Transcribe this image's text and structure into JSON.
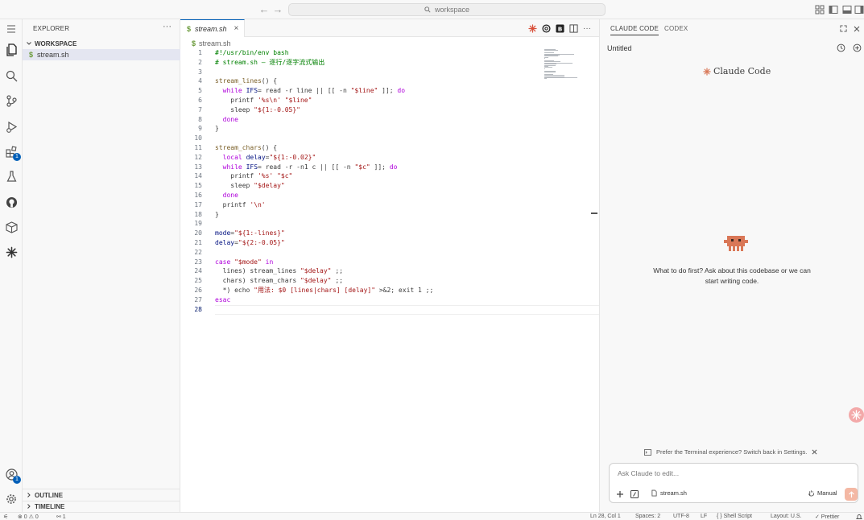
{
  "titlebar": {
    "back_icon": "arrow-left-icon",
    "forward_icon": "arrow-right-icon",
    "search_placeholder": "workspace"
  },
  "sidebar": {
    "title": "EXPLORER",
    "more": "···",
    "workspace_label": "WORKSPACE",
    "file": {
      "icon": "$",
      "name": "stream.sh"
    },
    "outline_label": "OUTLINE",
    "timeline_label": "TIMELINE",
    "extensions_badge": "1",
    "accounts_badge": "1"
  },
  "editor": {
    "tab": {
      "icon": "$",
      "label": "stream.sh",
      "close": "×"
    },
    "breadcrumb": {
      "icon": "$",
      "label": "stream.sh"
    },
    "lines": [
      [
        {
          "t": "#!/usr/bin/env bash",
          "c": "cmt"
        }
      ],
      [
        {
          "t": "# stream.sh — 逐行/逐字流式输出",
          "c": "cmt"
        }
      ],
      [],
      [
        {
          "t": "stream_lines",
          "c": "fn"
        },
        {
          "t": "() {",
          "c": "op"
        }
      ],
      [
        {
          "t": "  "
        },
        {
          "t": "while",
          "c": "kw"
        },
        {
          "t": " "
        },
        {
          "t": "IFS",
          "c": "var"
        },
        {
          "t": "= read -r line || [[ -n "
        },
        {
          "t": "\"$line\"",
          "c": "str"
        },
        {
          "t": " ]]; "
        },
        {
          "t": "do",
          "c": "kw"
        }
      ],
      [
        {
          "t": "    printf "
        },
        {
          "t": "'%s\\n'",
          "c": "str"
        },
        {
          "t": " "
        },
        {
          "t": "\"$line\"",
          "c": "str"
        }
      ],
      [
        {
          "t": "    sleep "
        },
        {
          "t": "\"${1:-0.05}\"",
          "c": "str"
        }
      ],
      [
        {
          "t": "  "
        },
        {
          "t": "done",
          "c": "kw"
        }
      ],
      [
        {
          "t": "}"
        }
      ],
      [],
      [
        {
          "t": "stream_chars",
          "c": "fn"
        },
        {
          "t": "() {"
        }
      ],
      [
        {
          "t": "  "
        },
        {
          "t": "local",
          "c": "kw"
        },
        {
          "t": " "
        },
        {
          "t": "delay",
          "c": "var"
        },
        {
          "t": "="
        },
        {
          "t": "\"${1:-0.02}\"",
          "c": "str"
        }
      ],
      [
        {
          "t": "  "
        },
        {
          "t": "while",
          "c": "kw"
        },
        {
          "t": " "
        },
        {
          "t": "IFS",
          "c": "var"
        },
        {
          "t": "= read -r -n1 c || [[ -n "
        },
        {
          "t": "\"$c\"",
          "c": "str"
        },
        {
          "t": " ]]; "
        },
        {
          "t": "do",
          "c": "kw"
        }
      ],
      [
        {
          "t": "    printf "
        },
        {
          "t": "'%s'",
          "c": "str"
        },
        {
          "t": " "
        },
        {
          "t": "\"$c\"",
          "c": "str"
        }
      ],
      [
        {
          "t": "    sleep "
        },
        {
          "t": "\"$delay\"",
          "c": "str"
        }
      ],
      [
        {
          "t": "  "
        },
        {
          "t": "done",
          "c": "kw"
        }
      ],
      [
        {
          "t": "  printf "
        },
        {
          "t": "'\\n'",
          "c": "str"
        }
      ],
      [
        {
          "t": "}"
        }
      ],
      [],
      [
        {
          "t": "mode",
          "c": "var"
        },
        {
          "t": "="
        },
        {
          "t": "\"${1:-lines}\"",
          "c": "str"
        }
      ],
      [
        {
          "t": "delay",
          "c": "var"
        },
        {
          "t": "="
        },
        {
          "t": "\"${2:-0.05}\"",
          "c": "str"
        }
      ],
      [],
      [
        {
          "t": "case",
          "c": "kw"
        },
        {
          "t": " "
        },
        {
          "t": "\"$mode\"",
          "c": "str"
        },
        {
          "t": " "
        },
        {
          "t": "in",
          "c": "kw"
        }
      ],
      [
        {
          "t": "  lines) stream_lines "
        },
        {
          "t": "\"$delay\"",
          "c": "str"
        },
        {
          "t": " ;;"
        }
      ],
      [
        {
          "t": "  chars) stream_chars "
        },
        {
          "t": "\"$delay\"",
          "c": "str"
        },
        {
          "t": " ;;"
        }
      ],
      [
        {
          "t": "  *) echo "
        },
        {
          "t": "\"用法: $0 [lines|chars] [delay]\"",
          "c": "str"
        },
        {
          "t": " >&2; exit 1 ;;"
        }
      ],
      [
        {
          "t": "esac",
          "c": "kw"
        }
      ],
      []
    ],
    "current_line": 28
  },
  "panel": {
    "tab_claude": "CLAUDE CODE",
    "tab_codex": "CODEX",
    "session_title": "Untitled",
    "logo_text": "Claude Code",
    "empty_message": "What to do first? Ask about this codebase or we can start writing code.",
    "hint": "Prefer the Terminal experience? Switch back in Settings.",
    "prompt_placeholder": "Ask Claude to edit...",
    "file_chip": "stream.sh",
    "mode_chip": "Manual",
    "brand_color": "#d97757"
  },
  "statusbar": {
    "remote": "⚟",
    "problems": "⊗ 0 ⚠ 0",
    "ports": "⚯ 1",
    "position": "Ln 28, Col 1",
    "spaces": "Spaces: 2",
    "encoding": "UTF-8",
    "eol": "LF",
    "language": "{ } Shell Script",
    "layout": "Layout: U.S.",
    "prettier": "✓ Prettier"
  }
}
